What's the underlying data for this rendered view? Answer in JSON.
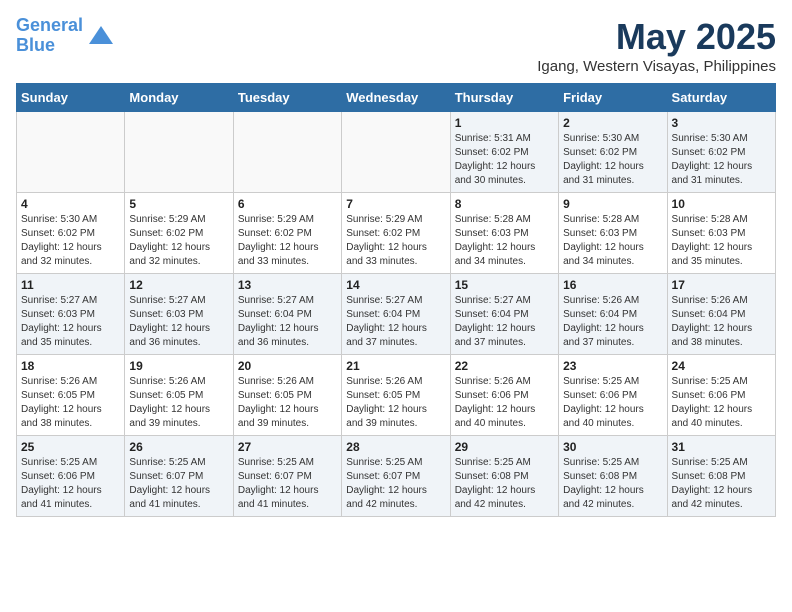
{
  "header": {
    "logo_line1": "General",
    "logo_line2": "Blue",
    "month_title": "May 2025",
    "subtitle": "Igang, Western Visayas, Philippines"
  },
  "weekdays": [
    "Sunday",
    "Monday",
    "Tuesday",
    "Wednesday",
    "Thursday",
    "Friday",
    "Saturday"
  ],
  "weeks": [
    [
      {
        "day": "",
        "sunrise": "",
        "sunset": "",
        "daylight": ""
      },
      {
        "day": "",
        "sunrise": "",
        "sunset": "",
        "daylight": ""
      },
      {
        "day": "",
        "sunrise": "",
        "sunset": "",
        "daylight": ""
      },
      {
        "day": "",
        "sunrise": "",
        "sunset": "",
        "daylight": ""
      },
      {
        "day": "1",
        "sunrise": "5:31 AM",
        "sunset": "6:02 PM",
        "daylight": "12 hours and 30 minutes."
      },
      {
        "day": "2",
        "sunrise": "5:30 AM",
        "sunset": "6:02 PM",
        "daylight": "12 hours and 31 minutes."
      },
      {
        "day": "3",
        "sunrise": "5:30 AM",
        "sunset": "6:02 PM",
        "daylight": "12 hours and 31 minutes."
      }
    ],
    [
      {
        "day": "4",
        "sunrise": "5:30 AM",
        "sunset": "6:02 PM",
        "daylight": "12 hours and 32 minutes."
      },
      {
        "day": "5",
        "sunrise": "5:29 AM",
        "sunset": "6:02 PM",
        "daylight": "12 hours and 32 minutes."
      },
      {
        "day": "6",
        "sunrise": "5:29 AM",
        "sunset": "6:02 PM",
        "daylight": "12 hours and 33 minutes."
      },
      {
        "day": "7",
        "sunrise": "5:29 AM",
        "sunset": "6:02 PM",
        "daylight": "12 hours and 33 minutes."
      },
      {
        "day": "8",
        "sunrise": "5:28 AM",
        "sunset": "6:03 PM",
        "daylight": "12 hours and 34 minutes."
      },
      {
        "day": "9",
        "sunrise": "5:28 AM",
        "sunset": "6:03 PM",
        "daylight": "12 hours and 34 minutes."
      },
      {
        "day": "10",
        "sunrise": "5:28 AM",
        "sunset": "6:03 PM",
        "daylight": "12 hours and 35 minutes."
      }
    ],
    [
      {
        "day": "11",
        "sunrise": "5:27 AM",
        "sunset": "6:03 PM",
        "daylight": "12 hours and 35 minutes."
      },
      {
        "day": "12",
        "sunrise": "5:27 AM",
        "sunset": "6:03 PM",
        "daylight": "12 hours and 36 minutes."
      },
      {
        "day": "13",
        "sunrise": "5:27 AM",
        "sunset": "6:04 PM",
        "daylight": "12 hours and 36 minutes."
      },
      {
        "day": "14",
        "sunrise": "5:27 AM",
        "sunset": "6:04 PM",
        "daylight": "12 hours and 37 minutes."
      },
      {
        "day": "15",
        "sunrise": "5:27 AM",
        "sunset": "6:04 PM",
        "daylight": "12 hours and 37 minutes."
      },
      {
        "day": "16",
        "sunrise": "5:26 AM",
        "sunset": "6:04 PM",
        "daylight": "12 hours and 37 minutes."
      },
      {
        "day": "17",
        "sunrise": "5:26 AM",
        "sunset": "6:04 PM",
        "daylight": "12 hours and 38 minutes."
      }
    ],
    [
      {
        "day": "18",
        "sunrise": "5:26 AM",
        "sunset": "6:05 PM",
        "daylight": "12 hours and 38 minutes."
      },
      {
        "day": "19",
        "sunrise": "5:26 AM",
        "sunset": "6:05 PM",
        "daylight": "12 hours and 39 minutes."
      },
      {
        "day": "20",
        "sunrise": "5:26 AM",
        "sunset": "6:05 PM",
        "daylight": "12 hours and 39 minutes."
      },
      {
        "day": "21",
        "sunrise": "5:26 AM",
        "sunset": "6:05 PM",
        "daylight": "12 hours and 39 minutes."
      },
      {
        "day": "22",
        "sunrise": "5:26 AM",
        "sunset": "6:06 PM",
        "daylight": "12 hours and 40 minutes."
      },
      {
        "day": "23",
        "sunrise": "5:25 AM",
        "sunset": "6:06 PM",
        "daylight": "12 hours and 40 minutes."
      },
      {
        "day": "24",
        "sunrise": "5:25 AM",
        "sunset": "6:06 PM",
        "daylight": "12 hours and 40 minutes."
      }
    ],
    [
      {
        "day": "25",
        "sunrise": "5:25 AM",
        "sunset": "6:06 PM",
        "daylight": "12 hours and 41 minutes."
      },
      {
        "day": "26",
        "sunrise": "5:25 AM",
        "sunset": "6:07 PM",
        "daylight": "12 hours and 41 minutes."
      },
      {
        "day": "27",
        "sunrise": "5:25 AM",
        "sunset": "6:07 PM",
        "daylight": "12 hours and 41 minutes."
      },
      {
        "day": "28",
        "sunrise": "5:25 AM",
        "sunset": "6:07 PM",
        "daylight": "12 hours and 42 minutes."
      },
      {
        "day": "29",
        "sunrise": "5:25 AM",
        "sunset": "6:08 PM",
        "daylight": "12 hours and 42 minutes."
      },
      {
        "day": "30",
        "sunrise": "5:25 AM",
        "sunset": "6:08 PM",
        "daylight": "12 hours and 42 minutes."
      },
      {
        "day": "31",
        "sunrise": "5:25 AM",
        "sunset": "6:08 PM",
        "daylight": "12 hours and 42 minutes."
      }
    ]
  ]
}
